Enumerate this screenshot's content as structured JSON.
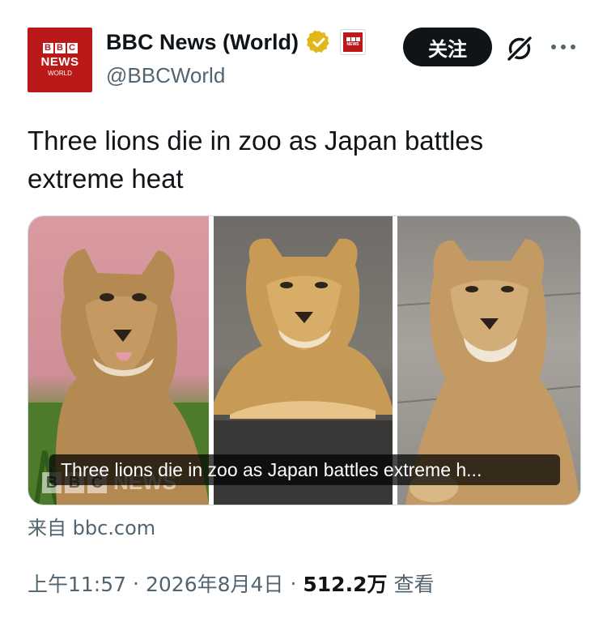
{
  "account": {
    "avatar_blocks": [
      "B",
      "B",
      "C"
    ],
    "avatar_news": "NEWS",
    "avatar_world": "WORLD",
    "display_name": "BBC News (World)",
    "handle": "@BBCWorld",
    "verified_icon": "gold-verified-badge",
    "affiliation_icon": "bbc-news-affiliate-badge"
  },
  "actions": {
    "follow_label": "关注",
    "grok_icon": "grok-slash-icon",
    "more_icon": "more-horizontal-icon"
  },
  "tweet": {
    "text": "Three lions die in zoo as Japan battles extreme heat"
  },
  "card": {
    "caption": "Three lions die in zoo as Japan battles extreme h...",
    "watermark_blocks": [
      "B",
      "B",
      "C"
    ],
    "watermark_word": "NEWS"
  },
  "source": {
    "text": "来自 bbc.com"
  },
  "meta": {
    "time": "上午11:57",
    "date": "2026年8月4日",
    "separator": "·",
    "views": "512.2万",
    "views_label": "查看"
  },
  "colors": {
    "text": "#0f1419",
    "secondary": "#536471",
    "bbc_red": "#bb1919",
    "verified_gold": "#e2b719"
  }
}
